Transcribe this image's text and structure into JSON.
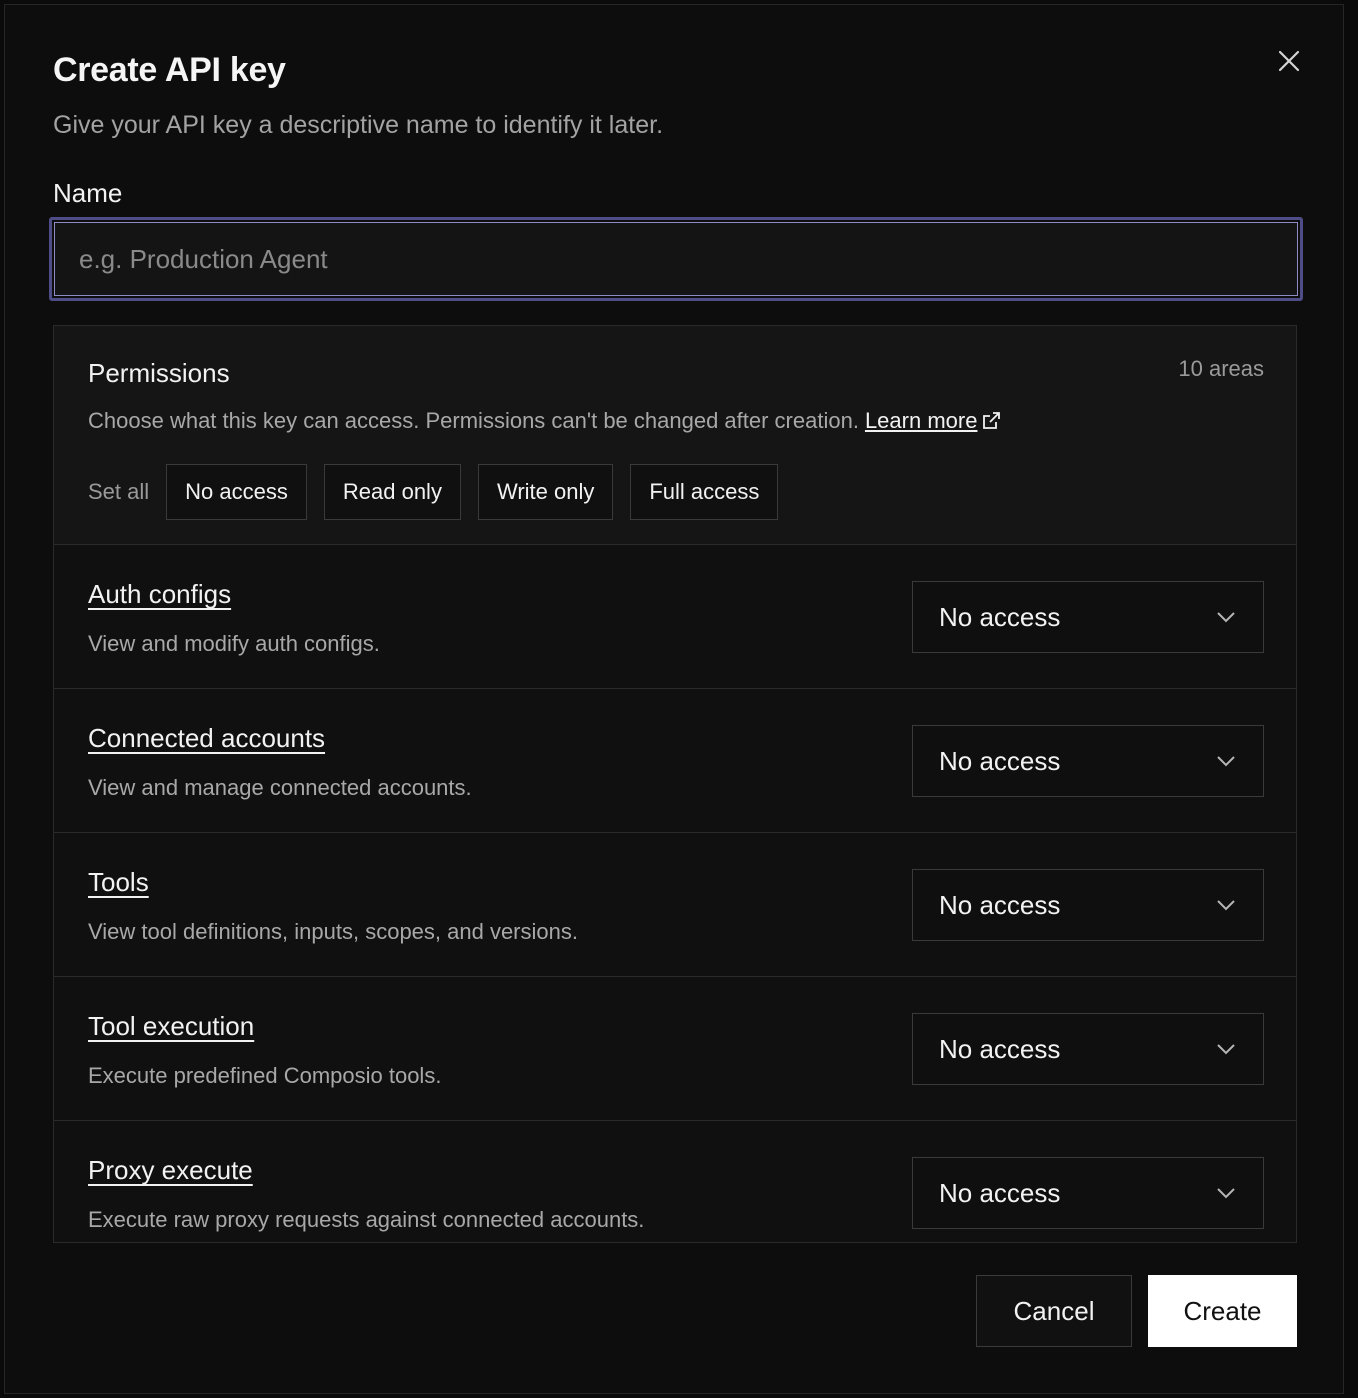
{
  "dialog": {
    "title": "Create API key",
    "subtitle": "Give your API key a descriptive name to identify it later.",
    "close_icon": "close-icon"
  },
  "name_field": {
    "label": "Name",
    "placeholder": "e.g. Production Agent",
    "value": ""
  },
  "permissions": {
    "title": "Permissions",
    "count": "10 areas",
    "description": "Choose what this key can access. Permissions can't be changed after creation.",
    "learn_more": "Learn more",
    "learn_more_icon": "external-link-icon",
    "set_all_label": "Set all",
    "set_all_options": [
      "No access",
      "Read only",
      "Write only",
      "Full access"
    ],
    "rows": [
      {
        "title": "Auth configs",
        "description": "View and modify auth configs.",
        "value": "No access"
      },
      {
        "title": "Connected accounts",
        "description": "View and manage connected accounts.",
        "value": "No access"
      },
      {
        "title": "Tools",
        "description": "View tool definitions, inputs, scopes, and versions.",
        "value": "No access"
      },
      {
        "title": "Tool execution",
        "description": "Execute predefined Composio tools.",
        "value": "No access"
      },
      {
        "title": "Proxy execute",
        "description": "Execute raw proxy requests against connected accounts.",
        "value": "No access"
      }
    ]
  },
  "footer": {
    "cancel_label": "Cancel",
    "create_label": "Create"
  },
  "colors": {
    "background": "#0d0d0d",
    "panel_header": "#151515",
    "focus_ring": "#4f4d87",
    "primary_button": "#ffffff"
  }
}
